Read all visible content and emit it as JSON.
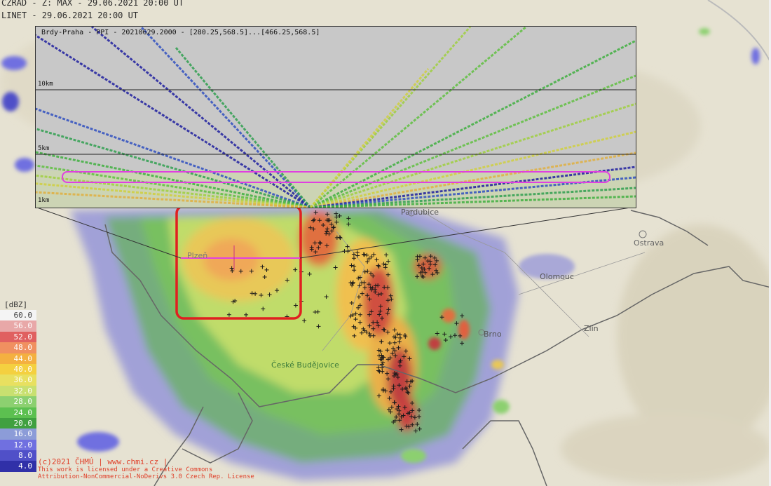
{
  "header": {
    "line1": "CZRAD - Z: MAX - 29.06.2021 20:00 UT",
    "line2": "LINET - 29.06.2021 20:00 UT"
  },
  "inset": {
    "title": "Brdy-Praha - PPI - 20210629.2000 - [280.25,568.5]...[466.25,568.5]",
    "levels": [
      "10km",
      "5km",
      "1km"
    ]
  },
  "legend": {
    "unit": "[dBZ]",
    "levels": [
      {
        "value": "60.0",
        "color": "#f4f4f4"
      },
      {
        "value": "56.0",
        "color": "#e8a8a8"
      },
      {
        "value": "52.0",
        "color": "#e06060"
      },
      {
        "value": "48.0",
        "color": "#f09060"
      },
      {
        "value": "44.0",
        "color": "#f4b040"
      },
      {
        "value": "40.0",
        "color": "#f4d040"
      },
      {
        "value": "36.0",
        "color": "#e8e060"
      },
      {
        "value": "32.0",
        "color": "#c8e070"
      },
      {
        "value": "28.0",
        "color": "#8cd070"
      },
      {
        "value": "24.0",
        "color": "#5cc050"
      },
      {
        "value": "20.0",
        "color": "#40a040"
      },
      {
        "value": "16.0",
        "color": "#8c9cd8"
      },
      {
        "value": "12.0",
        "color": "#7070e0"
      },
      {
        "value": "8.0",
        "color": "#5050c8"
      },
      {
        "value": "4.0",
        "color": "#3030a8"
      }
    ]
  },
  "cities": [
    {
      "name": "Pardubice",
      "id": "pardubice"
    },
    {
      "name": "Ostrava",
      "id": "ostrava"
    },
    {
      "name": "Plzeň",
      "id": "plzen"
    },
    {
      "name": "Olomouc",
      "id": "olomouc"
    },
    {
      "name": "Brno",
      "id": "brno"
    },
    {
      "name": "Zlín",
      "id": "zlin"
    },
    {
      "name": "České Budějovice",
      "id": "ceske-budejovice"
    }
  ],
  "copyright": {
    "line1": "(c)2021 ČHMÚ | www.chmi.cz |",
    "line2": "This work is licensed under a Creative Commons",
    "line3": "Attribution-NonCommercial-NoDerivs 3.0 Czech Rep. License"
  },
  "colors": {
    "selection": "#e02020",
    "beam_box": "#e040e0",
    "lightning": "#1a1a1a"
  }
}
